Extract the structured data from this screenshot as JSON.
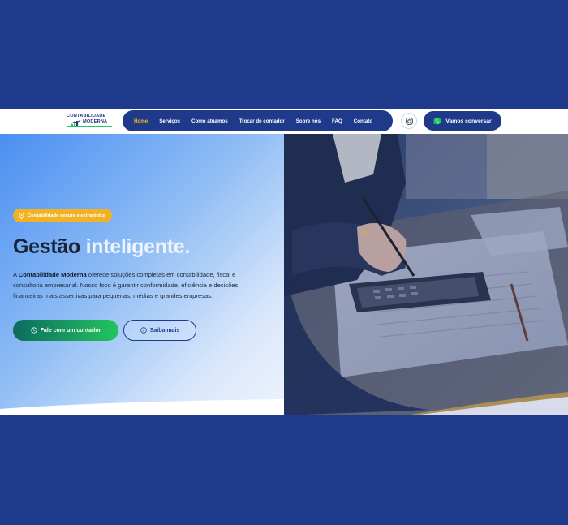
{
  "colors": {
    "page_background": "#1f3a8a",
    "brand_navy": "#1f3a8a",
    "accent_orange": "#f2b222",
    "nav_active": "#f5b61c",
    "whatsapp_green": "#22c55e"
  },
  "logo": {
    "line1": "CONTABILIDADE",
    "line2": "MODERNA"
  },
  "nav": {
    "items": [
      {
        "label": "Home",
        "active": true
      },
      {
        "label": "Serviços",
        "active": false
      },
      {
        "label": "Como atuamos",
        "active": false
      },
      {
        "label": "Trocar de contador",
        "active": false
      },
      {
        "label": "Sobre nós",
        "active": false
      },
      {
        "label": "FAQ",
        "active": false
      },
      {
        "label": "Contato",
        "active": false
      }
    ]
  },
  "header_actions": {
    "instagram_icon": "instagram-icon",
    "talk_label": "Vamos conversar",
    "talk_icon": "whatsapp-icon"
  },
  "hero": {
    "badge": "Contabilidade segura e estratégica",
    "badge_icon": "location-pin-icon",
    "headline_dark": "Gestão",
    "headline_light": "inteligente.",
    "desc_prefix": "A ",
    "desc_bold": "Contabilidade Moderna",
    "desc_rest": " oferece soluções completas em contabilidade, fiscal e consultoria empresarial. Nosso foco é garantir conformidade, eficiência e decisões financeiras mais assertivas para pequenas, médias e grandes empresas.",
    "cta_primary": "Fale com um contador",
    "cta_primary_icon": "whatsapp-icon",
    "cta_secondary": "Saiba mais",
    "cta_secondary_icon": "info-icon"
  }
}
